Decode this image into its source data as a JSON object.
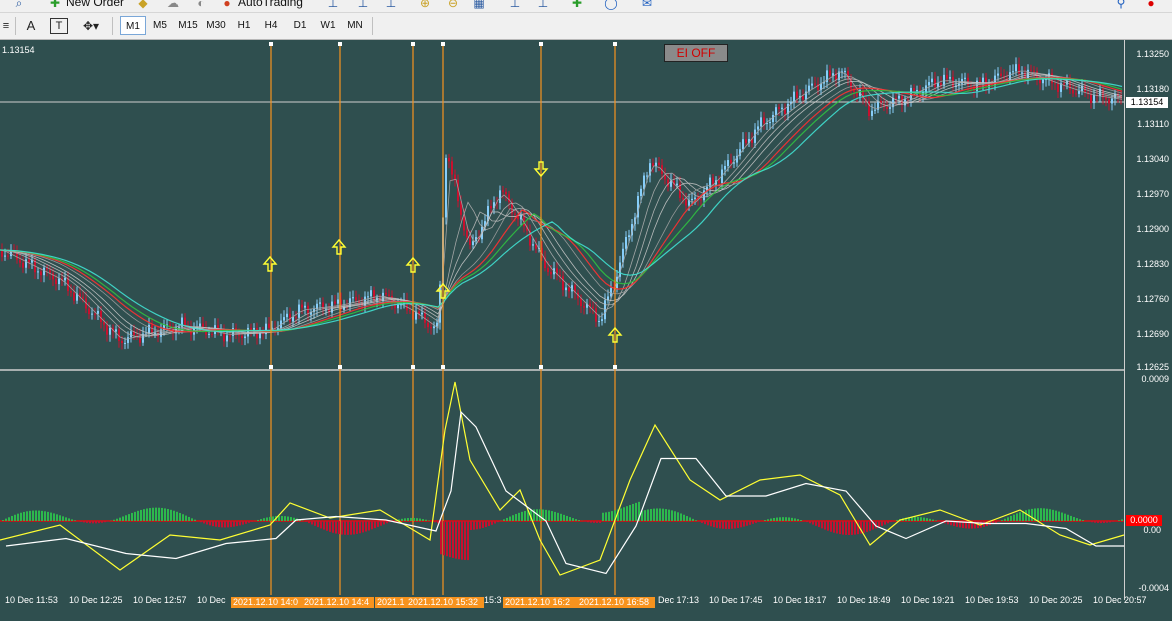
{
  "toolbar_top": {
    "new_order_label": "New Order",
    "autotrading_label": "AutoTrading"
  },
  "toolbar": {
    "timeframes": [
      "M1",
      "M5",
      "M15",
      "M30",
      "H1",
      "H4",
      "D1",
      "W1",
      "MN"
    ],
    "active_timeframe": "M1"
  },
  "chart": {
    "current_price_label": "1.13154",
    "ei_status_label": "EI OFF",
    "price_axis_labels": [
      "1.13250",
      "1.13180",
      "1.13110",
      "1.13040",
      "1.12970",
      "1.12900",
      "1.12830",
      "1.12760",
      "1.12690",
      "1.12625"
    ],
    "indicator_axis_top": "0.0009",
    "indicator_axis_zero": "0.00",
    "indicator_axis_bottom": "-0.0004",
    "indicator_current_value": "0.0000",
    "time_labels": [
      "10 Dec 11:53",
      "10 Dec 12:25",
      "10 Dec 12:57",
      "10 Dec",
      "15:3",
      "Dec 17:13",
      "10 Dec 17:45",
      "10 Dec 18:17",
      "10 Dec 18:49",
      "10 Dec 19:21",
      "10 Dec 19:53",
      "10 Dec 20:25",
      "10 Dec 20:57"
    ],
    "vline_labels": [
      "2021.12.10 14:0",
      "2021.12.10 14:4",
      "2021.1",
      "2021.12.10 15:32",
      "2021.12.10 16:2",
      "2021.12.10 16:58"
    ]
  },
  "colors": {
    "background": "#2f4f4f",
    "bull": "#87cefa",
    "bear": "#c8102e",
    "vline": "#f7931e",
    "arrow": "#ffff33",
    "signal_yellow": "#ffff33",
    "signal_white": "#ffffff",
    "zero_line": "#ff0000"
  }
}
